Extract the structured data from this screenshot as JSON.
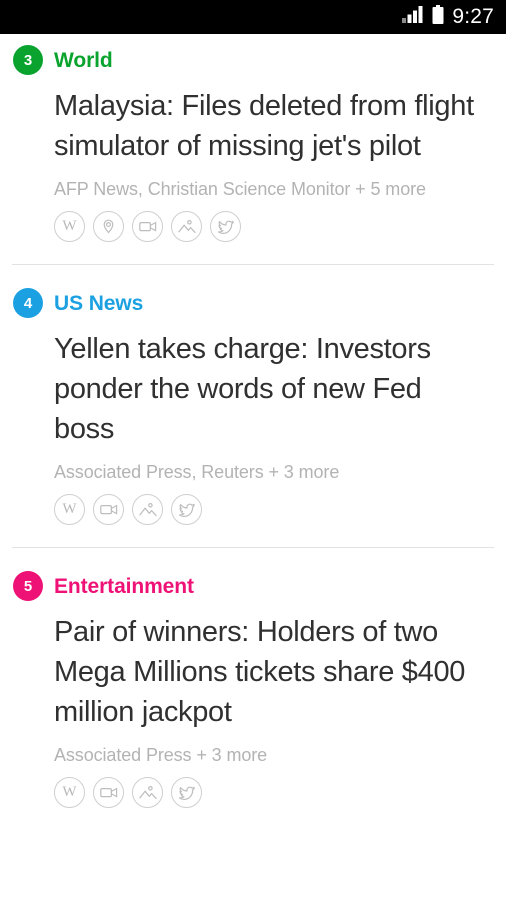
{
  "status_bar": {
    "time": "9:27",
    "signal_icon": "signal-bars-icon",
    "battery_icon": "battery-full-icon",
    "background": "#000000"
  },
  "colors": {
    "world": "#0aa32e",
    "us_news": "#1ba1e2",
    "entertainment": "#ee1277",
    "headline": "#303030",
    "sources": "#b3b3b3",
    "divider": "#e2e2e2",
    "chip_border": "#cfcfcf"
  },
  "feed": {
    "articles": [
      {
        "rank": "3",
        "category": "World",
        "category_color": "#0aa32e",
        "headline": "Malaysia: Files deleted from flight simulator of missing jet's pilot",
        "sources": "AFP News, Christian Science Monitor + 5 more",
        "icons": [
          "wikipedia-icon",
          "location-pin-icon",
          "video-camera-icon",
          "image-icon",
          "twitter-icon"
        ]
      },
      {
        "rank": "4",
        "category": "US News",
        "category_color": "#1ba1e2",
        "headline": "Yellen takes charge: Investors ponder the words of new Fed boss",
        "sources": "Associated Press, Reuters + 3 more",
        "icons": [
          "wikipedia-icon",
          "video-camera-icon",
          "image-icon",
          "twitter-icon"
        ]
      },
      {
        "rank": "5",
        "category": "Entertainment",
        "category_color": "#ee1277",
        "headline": "Pair of winners: Holders of two Mega Millions tickets share $400 million jackpot",
        "sources": "Associated Press + 3 more",
        "icons": [
          "wikipedia-icon",
          "video-camera-icon",
          "image-icon",
          "twitter-icon"
        ]
      }
    ]
  }
}
